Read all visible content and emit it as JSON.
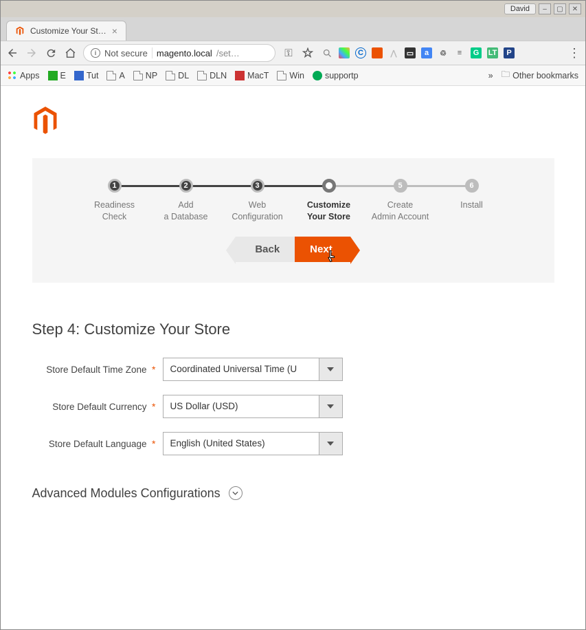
{
  "window": {
    "user": "David"
  },
  "browser": {
    "tab_title": "Customize Your St…",
    "url_notsecure": "Not secure",
    "url_host": "magento.local",
    "url_path": "/set…"
  },
  "bookmarks": {
    "apps": "Apps",
    "e": "E",
    "tut": "Tut",
    "a": "A",
    "np": "NP",
    "dl": "DL",
    "dln": "DLN",
    "mact": "MacT",
    "win": "Win",
    "supportp": "supportp",
    "other": "Other bookmarks"
  },
  "wizard": {
    "steps": [
      {
        "num": "1",
        "label1": "Readiness",
        "label2": "Check"
      },
      {
        "num": "2",
        "label1": "Add",
        "label2": "a Database"
      },
      {
        "num": "3",
        "label1": "Web",
        "label2": "Configuration"
      },
      {
        "num": "",
        "label1": "Customize",
        "label2": "Your Store"
      },
      {
        "num": "5",
        "label1": "Create",
        "label2": "Admin Account"
      },
      {
        "num": "6",
        "label1": "Install",
        "label2": ""
      }
    ],
    "back": "Back",
    "next": "Next"
  },
  "form": {
    "title": "Step 4: Customize Your Store",
    "tz_label": "Store Default Time Zone",
    "tz_value": "Coordinated Universal Time (U",
    "currency_label": "Store Default Currency",
    "currency_value": "US Dollar (USD)",
    "lang_label": "Store Default Language",
    "lang_value": "English (United States)",
    "advanced": "Advanced Modules Configurations"
  }
}
